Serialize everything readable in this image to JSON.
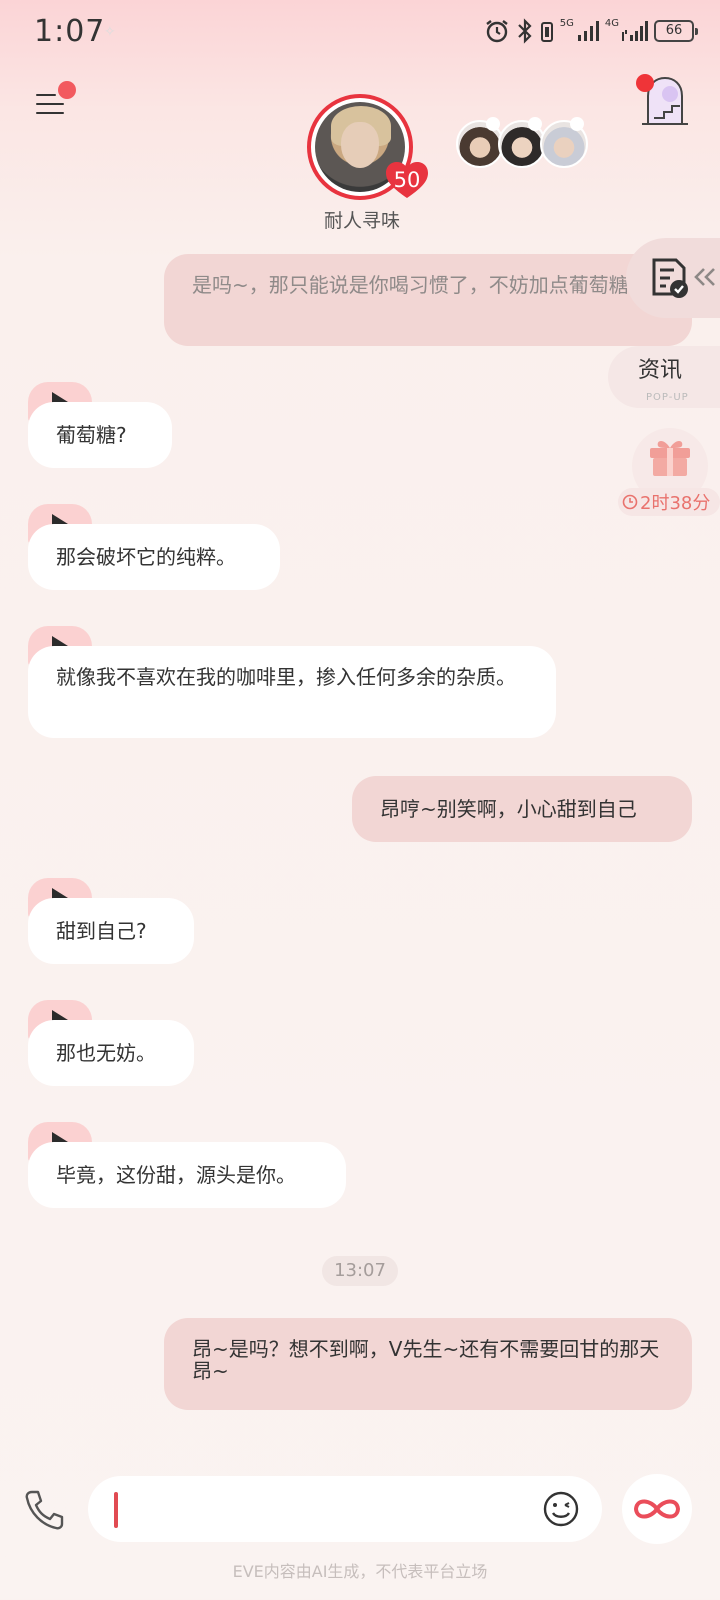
{
  "status_bar": {
    "time": "1:07",
    "network_labels": [
      "5G",
      "4G"
    ],
    "battery": "66"
  },
  "header": {
    "character_name": "耐人寻味",
    "level": "50"
  },
  "side": {
    "news_title": "资讯",
    "news_sub": "POP-UP",
    "gift_timer": "2时38分"
  },
  "messages": [
    {
      "role": "user",
      "text": "是吗~，那只能说是你喝习惯了，不妨加点葡萄糖？"
    },
    {
      "role": "ai",
      "text": "葡萄糖?"
    },
    {
      "role": "ai",
      "text": "那会破坏它的纯粹。"
    },
    {
      "role": "ai",
      "text": "就像我不喜欢在我的咖啡里，掺入任何多余的杂质。"
    },
    {
      "role": "user",
      "text": "昂哼~别笑啊，小心甜到自己"
    },
    {
      "role": "ai",
      "text": "甜到自己?"
    },
    {
      "role": "ai",
      "text": "那也无妨。"
    },
    {
      "role": "ai",
      "text": "毕竟，这份甜，源头是你。"
    },
    {
      "role": "user",
      "text": "昂~是吗？想不到啊，V先生~还有不需要回甘的那天昂~"
    }
  ],
  "timestamp": "13:07",
  "input": {
    "value": ""
  },
  "footer_note": "EVE内容由AI生成，不代表平台立场",
  "colors": {
    "accent_red": "#e8343f",
    "user_bubble": "#f2d6d4",
    "ai_bubble": "#ffffff",
    "play_tab": "#fbd1d1"
  },
  "icons": [
    "alarm-icon",
    "bluetooth-icon",
    "sim-icon",
    "signal-icon",
    "battery-icon",
    "menu-icon",
    "door-icon",
    "document-check-icon",
    "gift-icon",
    "clock-icon",
    "play-icon",
    "phone-icon",
    "emoji-icon",
    "infinity-icon"
  ]
}
